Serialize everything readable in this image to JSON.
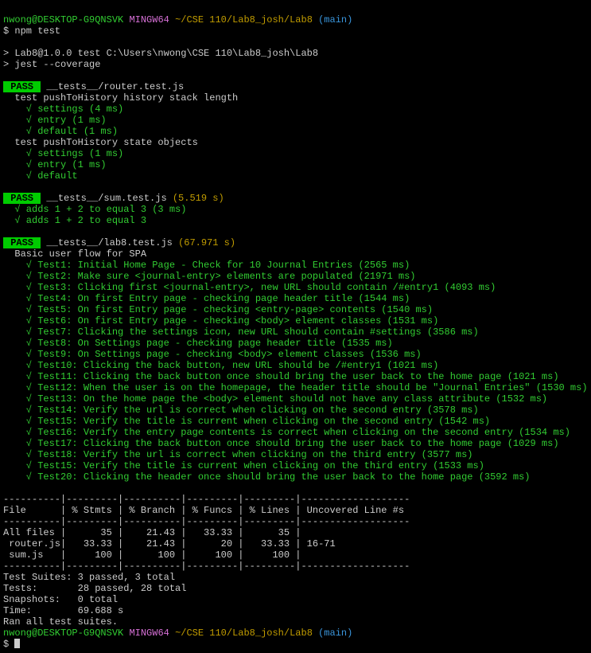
{
  "prompt1": {
    "user": "nwong@DESKTOP-G9QNSVK",
    "env": "MINGW64",
    "path": "~/CSE 110/Lab8_josh/Lab8",
    "branch": "(main)"
  },
  "cmd1": "$ npm test",
  "blank": "",
  "runLine": "> Lab8@1.0.0 test C:\\Users\\nwong\\CSE 110\\Lab8_josh\\Lab8",
  "jestLine": "> jest --coverage",
  "pass": " PASS ",
  "suite1": {
    "file": "__tests__/router.test.js",
    "desc1": "  test pushToHistory history stack length",
    "l1": "    √ settings (4 ms)",
    "l2": "    √ entry (1 ms)",
    "l3": "    √ default (1 ms)",
    "desc2": "  test pushToHistory state objects",
    "l4": "    √ settings (1 ms)",
    "l5": "    √ entry (1 ms)",
    "l6": "    √ default"
  },
  "suite2": {
    "file": "__tests__/sum.test.js",
    "time": "(5.519 s)",
    "l1": "  √ adds 1 + 2 to equal 3 (3 ms)",
    "l2": "  √ adds 1 + 2 to equal 3"
  },
  "suite3": {
    "file": "__tests__/lab8.test.js",
    "time": "(67.971 s)",
    "desc": "  Basic user flow for SPA",
    "l1": "    √ Test1: Initial Home Page - Check for 10 Journal Entries (2565 ms)",
    "l2": "    √ Test2: Make sure <journal-entry> elements are populated (21971 ms)",
    "l3": "    √ Test3: Clicking first <journal-entry>, new URL should contain /#entry1 (4093 ms)",
    "l4": "    √ Test4: On first Entry page - checking page header title (1544 ms)",
    "l5": "    √ Test5: On first Entry page - checking <entry-page> contents (1540 ms)",
    "l6": "    √ Test6: On first Entry page - checking <body> element classes (1531 ms)",
    "l7": "    √ Test7: Clicking the settings icon, new URL should contain #settings (3586 ms)",
    "l8": "    √ Test8: On Settings page - checking page header title (1535 ms)",
    "l9": "    √ Test9: On Settings page - checking <body> element classes (1536 ms)",
    "l10": "    √ Test10: Clicking the back button, new URL should be /#entry1 (1021 ms)",
    "l11": "    √ Test11: Clicking the back button once should bring the user back to the home page (1021 ms)",
    "l12": "    √ Test12: When the user is on the homepage, the header title should be \"Journal Entries\" (1530 ms)",
    "l13": "    √ Test13: On the home page the <body> element should not have any class attribute (1532 ms)",
    "l14": "    √ Test14: Verify the url is correct when clicking on the second entry (3578 ms)",
    "l15": "    √ Test15: Verify the title is current when clicking on the second entry (1542 ms)",
    "l16": "    √ Test16: Verify the entry page contents is correct when clicking on the second entry (1534 ms)",
    "l17": "    √ Test17: Clicking the back button once should bring the user back to the home page (1029 ms)",
    "l18": "    √ Test18: Verify the url is correct when clicking on the third entry (3577 ms)",
    "l19": "    √ Test15: Verify the title is current when clicking on the third entry (1533 ms)",
    "l20": "    √ Test20: Clicking the header once should bring the user back to the home page (3592 ms)"
  },
  "cov": {
    "sep1": "----------|---------|----------|---------|---------|-------------------",
    "hdr": "File      | % Stmts | % Branch | % Funcs | % Lines | Uncovered Line #s",
    "sep2": "----------|---------|----------|---------|---------|-------------------",
    "r1": "All files |      35 |    21.43 |   33.33 |      35 |",
    "r2": " router.js|   33.33 |    21.43 |      20 |   33.33 | 16-71",
    "r3": " sum.js   |     100 |      100 |     100 |     100 |",
    "sep3": "----------|---------|----------|---------|---------|-------------------"
  },
  "summary": {
    "l1": "Test Suites: 3 passed, 3 total",
    "l2": "Tests:       28 passed, 28 total",
    "l3": "Snapshots:   0 total",
    "l4": "Time:        69.688 s",
    "l5": "Ran all test suites."
  },
  "cmd2": "$ "
}
